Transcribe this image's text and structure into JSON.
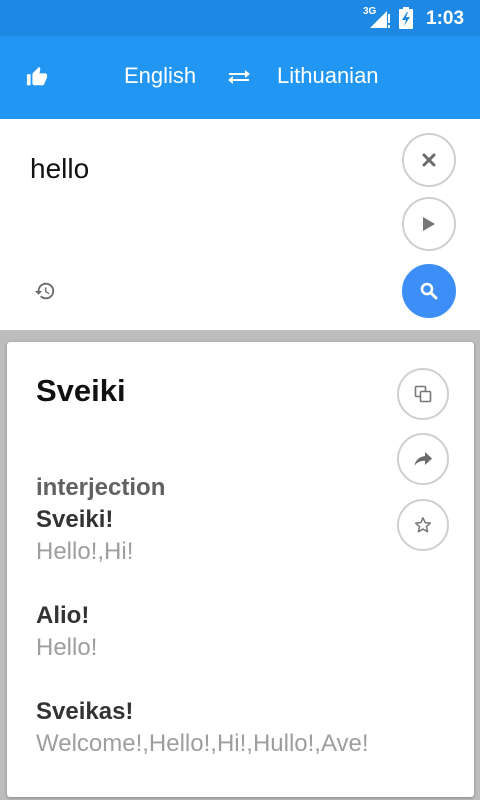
{
  "status_bar": {
    "network": "3G",
    "time": "1:03"
  },
  "toolbar": {
    "source_language": "English",
    "target_language": "Lithuanian",
    "like_icon": "thumbs-up-icon",
    "swap_icon": "swap-arrows-icon"
  },
  "input": {
    "text": "hello"
  },
  "result": {
    "main_translation": "Sveiki",
    "part_of_speech": "interjection",
    "entries": [
      {
        "word": "Sveiki!",
        "meaning": "Hello!,Hi!"
      },
      {
        "word": "Alio!",
        "meaning": "Hello!"
      },
      {
        "word": "Sveikas!",
        "meaning": "Welcome!,Hello!,Hi!,Hullo!,Ave!"
      }
    ]
  },
  "colors": {
    "status_bar": "#1e88e5",
    "toolbar": "#2196f3",
    "search_button": "#3d8ef7"
  }
}
